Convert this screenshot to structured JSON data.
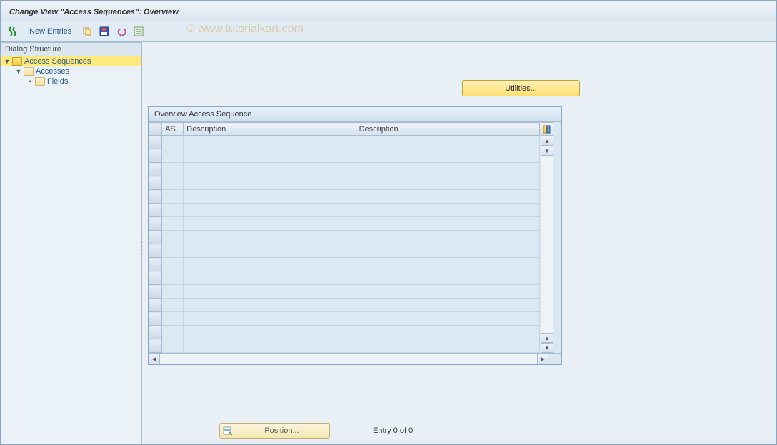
{
  "title": "Change View \"Access Sequences\": Overview",
  "watermark": "© www.tutorialkart.com",
  "toolbar": {
    "new_entries_label": "New Entries"
  },
  "sidebar": {
    "header": "Dialog Structure",
    "nodes": [
      {
        "label": "Access Sequences",
        "level": 0,
        "expanded": true,
        "selected": true,
        "open_folder": true
      },
      {
        "label": "Accesses",
        "level": 1,
        "expanded": true,
        "selected": false,
        "open_folder": false
      },
      {
        "label": "Fields",
        "level": 2,
        "expanded": false,
        "selected": false,
        "open_folder": false
      }
    ]
  },
  "utilities_label": "Utilities...",
  "table": {
    "title": "Overview Access Sequence",
    "columns": {
      "as": "AS",
      "desc1": "Description",
      "desc2": "Description"
    },
    "row_count": 16
  },
  "position_label": "Position...",
  "entry_label": "Entry 0 of 0"
}
